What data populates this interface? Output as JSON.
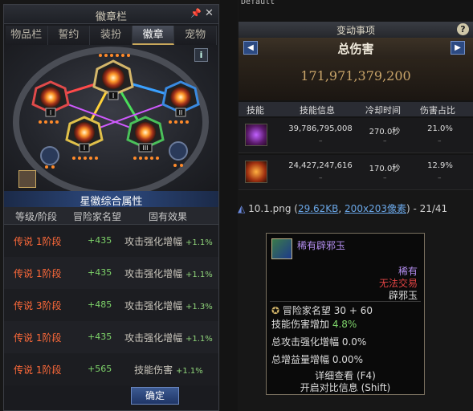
{
  "emblem_window": {
    "title": "徽章栏",
    "pin_icon": "pin-icon",
    "close_label": "✕",
    "tabs": [
      {
        "label": "物品栏"
      },
      {
        "label": "誓约"
      },
      {
        "label": "装扮"
      },
      {
        "label": "徽章"
      },
      {
        "label": "宠物"
      }
    ],
    "active_tab": "徽章",
    "info_label": "i",
    "node_labels": [
      "I",
      "I",
      "II",
      "I",
      "III"
    ],
    "stats_header": "星徽综合属性",
    "columns": [
      "等级/阶段",
      "冒险家名望",
      "固有效果"
    ],
    "rows": [
      {
        "level": "传说 1阶段",
        "fame": "+435",
        "effect": "攻击强化增幅",
        "value": "+1.1%"
      },
      {
        "level": "传说 1阶段",
        "fame": "+435",
        "effect": "攻击强化增幅",
        "value": "+1.1%"
      },
      {
        "level": "传说 3阶段",
        "fame": "+485",
        "effect": "攻击强化增幅",
        "value": "+1.3%"
      },
      {
        "level": "传说 1阶段",
        "fame": "+435",
        "effect": "攻击强化增幅",
        "value": "+1.1%"
      },
      {
        "level": "传说 1阶段",
        "fame": "+565",
        "effect": "技能伤害",
        "value": "+1.1%"
      }
    ],
    "ok_label": "确定"
  },
  "damage_panel": {
    "default_label": "Default",
    "title_bar": "变动事项",
    "help_label": "?",
    "prev_label": "◀",
    "next_label": "▶",
    "heading": "总伤害",
    "total": "171,971,379,200",
    "columns": [
      "技能",
      "技能信息",
      "冷却时间",
      "伤害占比"
    ],
    "rows": [
      {
        "icon": "purple-demon-skill-icon",
        "damage": "39,786,795,008",
        "cooldown": "270.0秒",
        "percent": "21.0%",
        "dash": "–"
      },
      {
        "icon": "fire-demon-skill-icon",
        "damage": "24,427,247,616",
        "cooldown": "170.0秒",
        "percent": "12.9%",
        "dash": "–"
      }
    ]
  },
  "file_caption": {
    "icon": "image-file-icon",
    "name": "10.1.png",
    "size": "29.62KB",
    "dims": "200x203像素",
    "position": "21/41"
  },
  "tooltip": {
    "name": "稀有辟邪玉",
    "rarity": "稀有",
    "trade": "无法交易",
    "type": "辟邪玉",
    "fame_label": "冒险家名望",
    "fame_value": "30 + 60",
    "stats": [
      {
        "label": "技能伤害增加",
        "value": "4.8%"
      },
      {
        "label": "总攻击强化增幅",
        "value": "0.0%"
      },
      {
        "label": "总增益量增幅",
        "value": "0.00%"
      }
    ],
    "detail": "详细查看 (F4)",
    "compare": "开启对比信息 (Shift)"
  },
  "colors": {
    "accent_blue": "#2d4a80",
    "legend_orange": "#ff6a3a",
    "fame_green": "#7ed46a",
    "rare_purple": "#b48ef0",
    "untradeable_red": "#e24444",
    "damage_gold": "#c9a56a"
  }
}
